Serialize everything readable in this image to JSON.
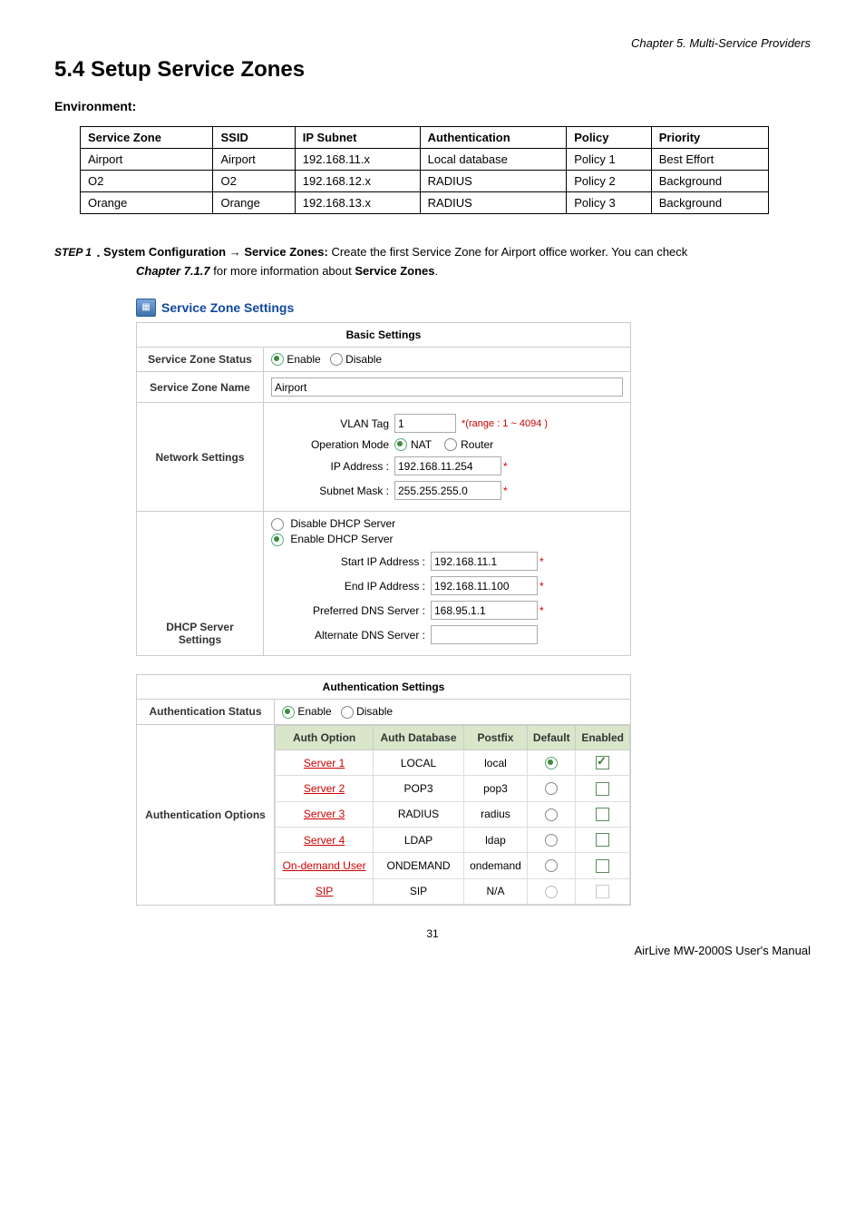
{
  "header": {
    "chapter_ref": "Chapter 5. Multi-Service Providers",
    "section_title": "5.4  Setup Service Zones"
  },
  "env": {
    "label": "Environment:",
    "columns": [
      "Service Zone",
      "SSID",
      "IP Subnet",
      "Authentication",
      "Policy",
      "Priority"
    ],
    "rows": [
      [
        "Airport",
        "Airport",
        "192.168.11.x",
        "Local database",
        "Policy 1",
        "Best Effort"
      ],
      [
        "O2",
        "O2",
        "192.168.12.x",
        "RADIUS",
        "Policy 2",
        "Background"
      ],
      [
        "Orange",
        "Orange",
        "192.168.13.x",
        "RADIUS",
        "Policy 3",
        "Background"
      ]
    ]
  },
  "step": {
    "label": "STEP 1",
    "bold1": "System Configuration → Service Zones:",
    "text1": " Create the first Service Zone for Airport office worker. You can check ",
    "bolditalic": "Chapter 7.1.7",
    "text2": " for more information about ",
    "bold2": "Service Zones",
    "text3": "."
  },
  "panel_title": "Service Zone Settings",
  "basic": {
    "head": "Basic Settings",
    "status_label": "Service Zone Status",
    "enable": "Enable",
    "disable": "Disable",
    "name_label": "Service Zone Name",
    "name_value": "Airport",
    "net_label": "Network Settings",
    "vlan_tag_label": "VLAN Tag",
    "vlan_tag_value": "1",
    "vlan_range": "*(range : 1 ~ 4094 )",
    "op_mode_label": "Operation Mode",
    "nat": "NAT",
    "router": "Router",
    "ip_label": "IP Address :",
    "ip_value": "192.168.11.254",
    "mask_label": "Subnet Mask :",
    "mask_value": "255.255.255.0",
    "dhcp_label": "DHCP Server Settings",
    "dhcp_disable": "Disable DHCP Server",
    "dhcp_enable": "Enable DHCP Server",
    "start_ip_label": "Start IP Address :",
    "start_ip_value": "192.168.11.1",
    "end_ip_label": "End IP Address :",
    "end_ip_value": "192.168.11.100",
    "pref_dns_label": "Preferred DNS Server :",
    "pref_dns_value": "168.95.1.1",
    "alt_dns_label": "Alternate DNS Server :",
    "alt_dns_value": ""
  },
  "auth": {
    "head": "Authentication Settings",
    "status_label": "Authentication Status",
    "enable": "Enable",
    "disable": "Disable",
    "options_label": "Authentication Options",
    "cols": [
      "Auth Option",
      "Auth Database",
      "Postfix",
      "Default",
      "Enabled"
    ],
    "rows": [
      {
        "opt": "Server 1",
        "db": "LOCAL",
        "postfix": "local",
        "default": true,
        "enabled": true,
        "active": true
      },
      {
        "opt": "Server 2",
        "db": "POP3",
        "postfix": "pop3",
        "default": false,
        "enabled": false,
        "active": true
      },
      {
        "opt": "Server 3",
        "db": "RADIUS",
        "postfix": "radius",
        "default": false,
        "enabled": false,
        "active": true
      },
      {
        "opt": "Server 4",
        "db": "LDAP",
        "postfix": "ldap",
        "default": false,
        "enabled": false,
        "active": true
      },
      {
        "opt": "On-demand User",
        "db": "ONDEMAND",
        "postfix": "ondemand",
        "default": false,
        "enabled": false,
        "active": true
      },
      {
        "opt": "SIP",
        "db": "SIP",
        "postfix": "N/A",
        "default": false,
        "enabled": false,
        "active": false
      }
    ]
  },
  "footer": {
    "page": "31",
    "manual": "AirLive MW-2000S User's Manual"
  }
}
